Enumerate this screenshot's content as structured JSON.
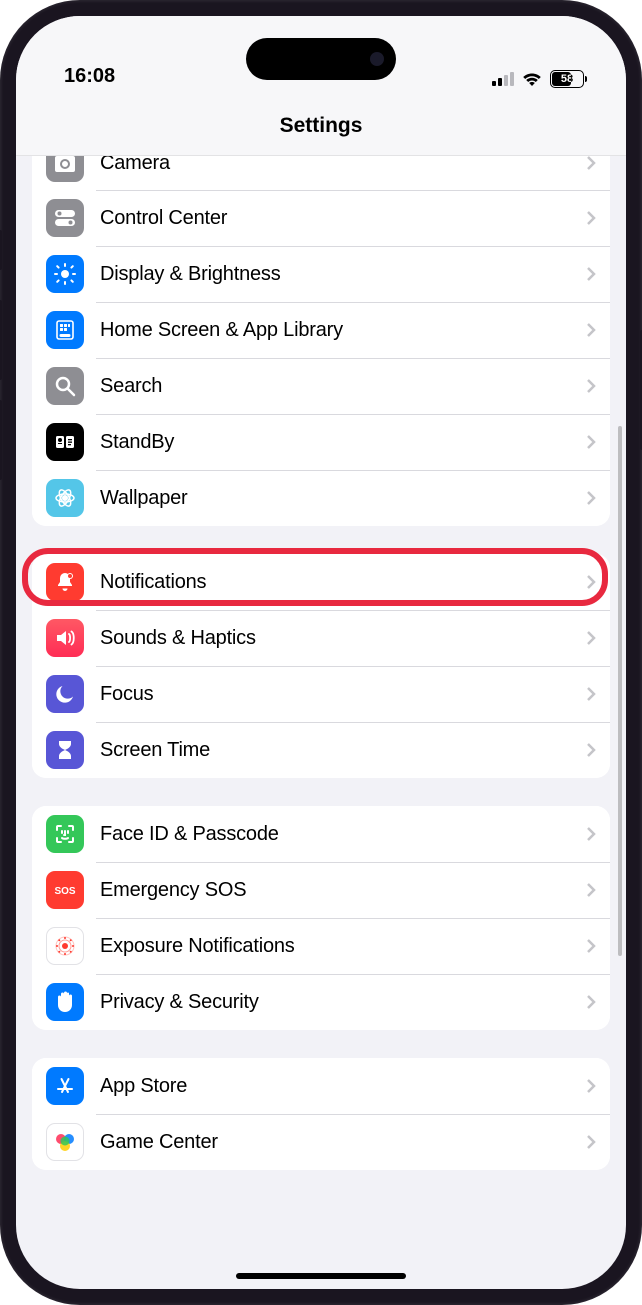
{
  "status": {
    "time": "16:08",
    "battery_percent": "58"
  },
  "header": {
    "title": "Settings"
  },
  "sections": [
    {
      "rows": [
        {
          "id": "camera",
          "label": "Camera",
          "icon": "camera-icon",
          "bg": "bg-gray",
          "first_cut": true
        },
        {
          "id": "control-center",
          "label": "Control Center",
          "icon": "toggle-icon",
          "bg": "bg-gray"
        },
        {
          "id": "display-brightness",
          "label": "Display & Brightness",
          "icon": "brightness-icon",
          "bg": "bg-blue"
        },
        {
          "id": "home-screen",
          "label": "Home Screen & App Library",
          "icon": "homegrid-icon",
          "bg": "bg-blue"
        },
        {
          "id": "search",
          "label": "Search",
          "icon": "search-icon",
          "bg": "bg-gray"
        },
        {
          "id": "standby",
          "label": "StandBy",
          "icon": "standby-icon",
          "bg": "bg-black"
        },
        {
          "id": "wallpaper",
          "label": "Wallpaper",
          "icon": "wallpaper-icon",
          "bg": "bg-teal"
        }
      ]
    },
    {
      "rows": [
        {
          "id": "notifications",
          "label": "Notifications",
          "icon": "bell-icon",
          "bg": "bg-red",
          "highlighted": true
        },
        {
          "id": "sounds-haptics",
          "label": "Sounds & Haptics",
          "icon": "speaker-icon",
          "bg": "bg-pink"
        },
        {
          "id": "focus",
          "label": "Focus",
          "icon": "moon-icon",
          "bg": "bg-indigo"
        },
        {
          "id": "screen-time",
          "label": "Screen Time",
          "icon": "hourglass-icon",
          "bg": "bg-indigo"
        }
      ]
    },
    {
      "rows": [
        {
          "id": "face-id",
          "label": "Face ID & Passcode",
          "icon": "faceid-icon",
          "bg": "bg-green"
        },
        {
          "id": "emergency-sos",
          "label": "Emergency SOS",
          "icon": "sos-icon",
          "bg": "bg-red"
        },
        {
          "id": "exposure",
          "label": "Exposure Notifications",
          "icon": "exposure-icon",
          "bg": "bg-white"
        },
        {
          "id": "privacy",
          "label": "Privacy & Security",
          "icon": "hand-icon",
          "bg": "bg-blue"
        }
      ]
    },
    {
      "rows": [
        {
          "id": "app-store",
          "label": "App Store",
          "icon": "appstore-icon",
          "bg": "bg-blue"
        },
        {
          "id": "game-center",
          "label": "Game Center",
          "icon": "gamecenter-icon",
          "bg": "bg-white"
        }
      ]
    }
  ]
}
